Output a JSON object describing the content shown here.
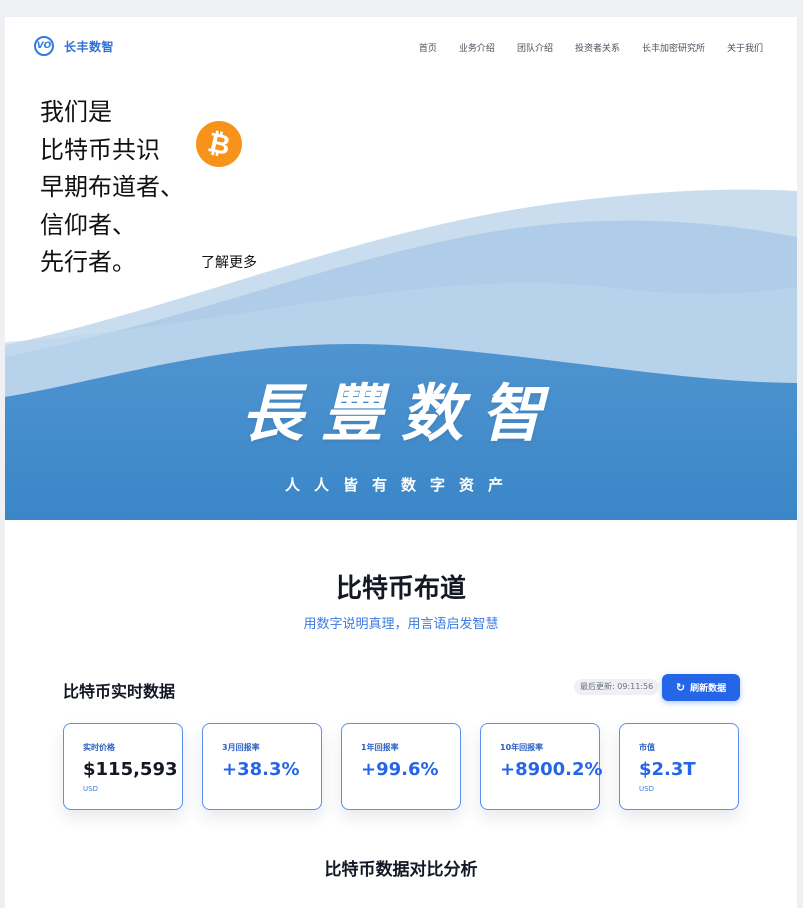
{
  "brand": {
    "name": "长丰数智",
    "logo_mark": "VO"
  },
  "nav": {
    "items": [
      {
        "label": "首页"
      },
      {
        "label": "业务介绍"
      },
      {
        "label": "团队介绍"
      },
      {
        "label": "投资者关系"
      },
      {
        "label": "长丰加密研究所"
      },
      {
        "label": "关于我们"
      }
    ]
  },
  "hero": {
    "lines": [
      "我们是",
      "比特币共识",
      "早期布道者、",
      "信仰者、",
      "先行者。"
    ],
    "btc_symbol": "₿",
    "learn_more": "了解更多",
    "calligraphy": "長豐数智",
    "slogan": "人人皆有数字资产"
  },
  "section": {
    "title": "比特币布道",
    "subtitle": "用数字说明真理，用言语启发智慧"
  },
  "realtime": {
    "title": "比特币实时数据",
    "last_update": "最后更新: 09:11:56",
    "refresh_label": "刷新数据",
    "cards": [
      {
        "label": "实时价格",
        "value": "$115,593",
        "unit": "USD"
      },
      {
        "label": "3月回报率",
        "value": "+38.3%",
        "unit": ""
      },
      {
        "label": "1年回报率",
        "value": "+99.6%",
        "unit": ""
      },
      {
        "label": "10年回报率",
        "value": "+8900.2%",
        "unit": ""
      },
      {
        "label": "市值",
        "value": "$2.3T",
        "unit": "USD"
      }
    ]
  },
  "comparison": {
    "title": "比特币数据对比分析"
  },
  "colors": {
    "accent": "#2566e8",
    "bitcoin": "#f7931a",
    "hero_blue": "#3d86c8"
  },
  "icons": {
    "refresh": "refresh-icon",
    "bitcoin": "bitcoin-icon",
    "logo": "logo-icon"
  }
}
